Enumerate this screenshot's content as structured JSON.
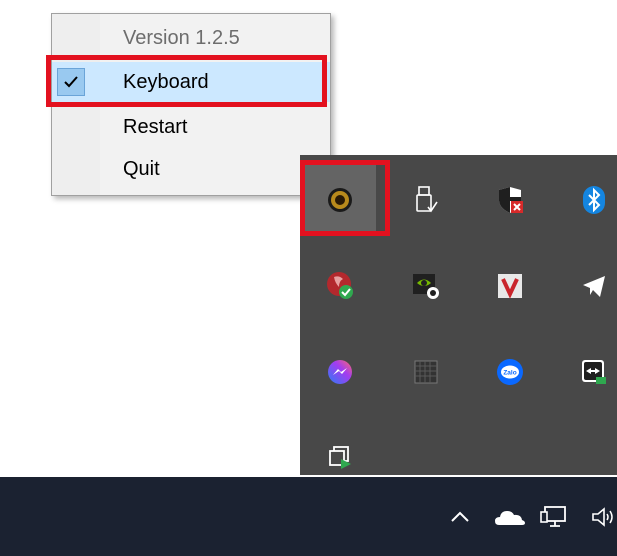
{
  "menu": {
    "items": [
      {
        "label": "Version 1.2.5",
        "enabled": false,
        "checked": false
      },
      {
        "label": "Keyboard",
        "enabled": true,
        "checked": true
      },
      {
        "label": "Restart",
        "enabled": true,
        "checked": false
      },
      {
        "label": "Quit",
        "enabled": true,
        "checked": false
      }
    ]
  },
  "tray_overflow": {
    "icons": [
      "app-round-icon",
      "usb-safely-remove-icon",
      "security-shield-icon",
      "bluetooth-icon",
      "defender-shield-icon",
      "nvidia-icon",
      "v-app-icon",
      "telegram-icon",
      "messenger-icon",
      "grid-app-icon",
      "zalo-icon",
      "teamviewer-icon",
      "copy-app-icon"
    ],
    "zalo_text": "Zalo"
  },
  "taskbar": {
    "icons": [
      "chevron-up-icon",
      "onedrive-cloud-icon",
      "network-icon",
      "volume-icon"
    ]
  },
  "colors": {
    "highlight": "#e3111f",
    "menu_selected": "#cce8ff",
    "tray_bg": "#484848",
    "taskbar_bg": "#1b2231"
  }
}
